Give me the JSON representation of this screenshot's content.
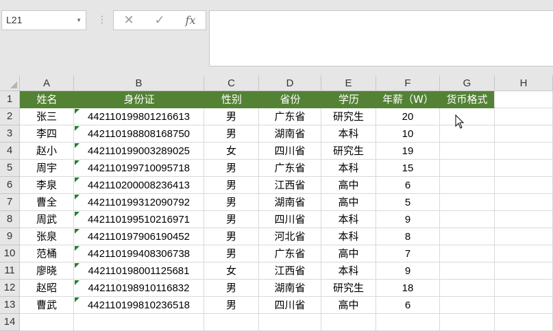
{
  "formula_bar": {
    "name_box": "L21",
    "fx_label": "fx",
    "cancel_icon": "cancel-x-icon",
    "enter_icon": "checkmark-icon",
    "formula_value": ""
  },
  "columns": [
    "A",
    "B",
    "C",
    "D",
    "E",
    "F",
    "G",
    "H"
  ],
  "row_numbers": [
    "1",
    "2",
    "3",
    "4",
    "5",
    "6",
    "7",
    "8",
    "9",
    "10",
    "11",
    "12",
    "13",
    "14"
  ],
  "header_row": [
    "姓名",
    "身份证",
    "性别",
    "省份",
    "学历",
    "年薪（W）",
    "货币格式"
  ],
  "rows": [
    {
      "name": "张三",
      "id": "442110199801216613",
      "gender": "男",
      "province": "广东省",
      "edu": "研究生",
      "salary": "20"
    },
    {
      "name": "李四",
      "id": "442110198808168750",
      "gender": "男",
      "province": "湖南省",
      "edu": "本科",
      "salary": "10"
    },
    {
      "name": "赵小",
      "id": "442110199003289025",
      "gender": "女",
      "province": "四川省",
      "edu": "研究生",
      "salary": "19"
    },
    {
      "name": "周宇",
      "id": "442110199710095718",
      "gender": "男",
      "province": "广东省",
      "edu": "本科",
      "salary": "15"
    },
    {
      "name": "李泉",
      "id": "442110200008236413",
      "gender": "男",
      "province": "江西省",
      "edu": "高中",
      "salary": "6"
    },
    {
      "name": "曹全",
      "id": "442110199312090792",
      "gender": "男",
      "province": "湖南省",
      "edu": "高中",
      "salary": "5"
    },
    {
      "name": "周武",
      "id": "442110199510216971",
      "gender": "男",
      "province": "四川省",
      "edu": "本科",
      "salary": "9"
    },
    {
      "name": "张泉",
      "id": "442110197906190452",
      "gender": "男",
      "province": "河北省",
      "edu": "本科",
      "salary": "8"
    },
    {
      "name": "范桶",
      "id": "442110199408306738",
      "gender": "男",
      "province": "广东省",
      "edu": "高中",
      "salary": "7"
    },
    {
      "name": "廖晓",
      "id": "442110198001125681",
      "gender": "女",
      "province": "江西省",
      "edu": "本科",
      "salary": "9"
    },
    {
      "name": "赵昭",
      "id": "442110198910116832",
      "gender": "男",
      "province": "湖南省",
      "edu": "研究生",
      "salary": "18"
    },
    {
      "name": "曹武",
      "id": "442110199810236518",
      "gender": "男",
      "province": "四川省",
      "edu": "高中",
      "salary": "6"
    }
  ],
  "colors": {
    "header_fill": "#548235",
    "header_text": "#ffffff",
    "text_marker": "#1e7e34"
  }
}
